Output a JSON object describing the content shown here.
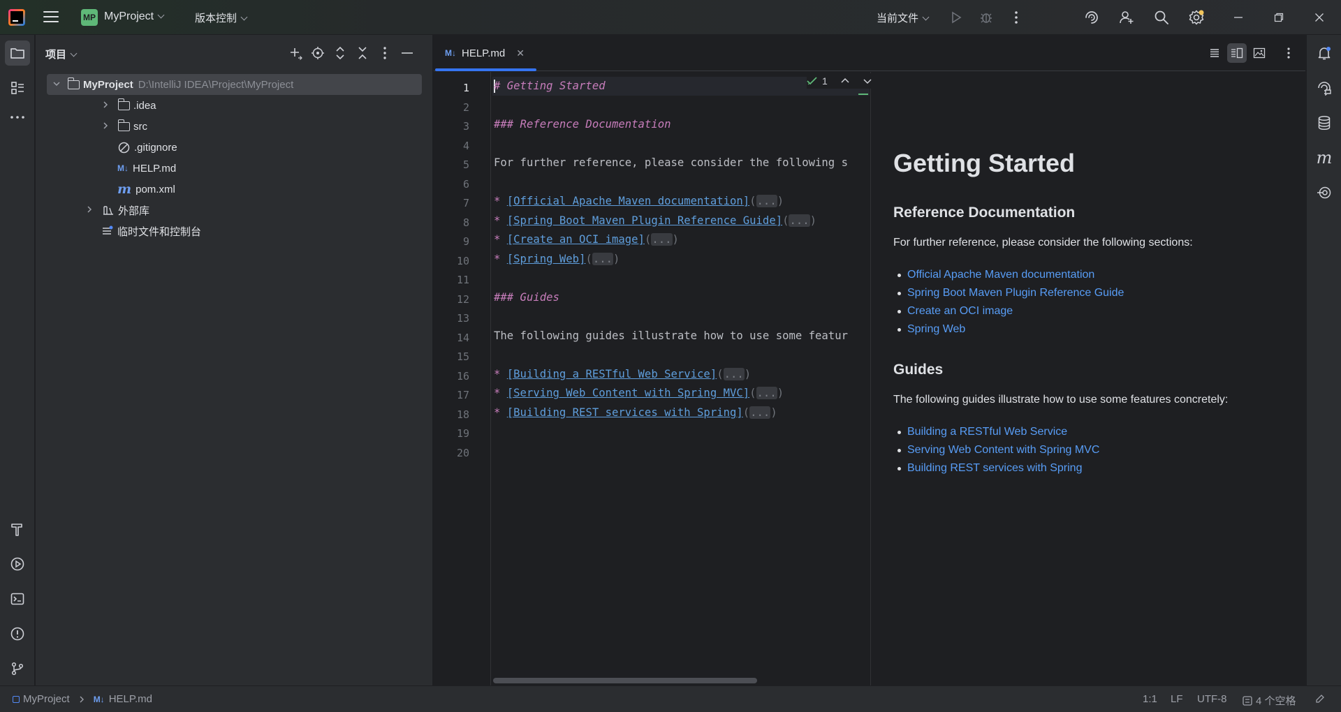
{
  "titlebar": {
    "project_badge": "MP",
    "project_name": "MyProject",
    "vcs_label": "版本控制",
    "run_config": "当前文件"
  },
  "project_panel": {
    "title": "项目",
    "tree": [
      {
        "name": "MyProject",
        "path": "D:\\IntelliJ IDEA\\Project\\MyProject"
      },
      {
        "name": ".idea"
      },
      {
        "name": "src"
      },
      {
        "name": ".gitignore"
      },
      {
        "name": "HELP.md"
      },
      {
        "name": "pom.xml"
      },
      {
        "name": "外部库"
      },
      {
        "name": "临时文件和控制台"
      }
    ]
  },
  "editor": {
    "tab_label": "HELP.md",
    "tab_badge": "M↓",
    "inspection_count": "1",
    "line_numbers": [
      "1",
      "2",
      "3",
      "4",
      "5",
      "6",
      "7",
      "8",
      "9",
      "10",
      "11",
      "12",
      "13",
      "14",
      "15",
      "16",
      "17",
      "18",
      "19",
      "20"
    ],
    "code": {
      "l1": "# Getting Started",
      "l3": "### Reference Documentation",
      "l5": "For further reference, please consider the following s",
      "l7": "Official Apache Maven documentation",
      "l8": "Spring Boot Maven Plugin Reference Guide",
      "l9": "Create an OCI image",
      "l10": "Spring Web",
      "l12": "### Guides",
      "l14": "The following guides illustrate how to use some featur",
      "l16": "Building a RESTful Web Service",
      "l17": "Serving Web Content with Spring MVC",
      "l18": "Building REST services with Spring",
      "fold": "..."
    },
    "preview": {
      "h1": "Getting Started",
      "h_ref": "Reference Documentation",
      "p_ref": "For further reference, please consider the following sections:",
      "ref_links": [
        "Official Apache Maven documentation",
        "Spring Boot Maven Plugin Reference Guide",
        "Create an OCI image",
        "Spring Web"
      ],
      "h_guides": "Guides",
      "p_guides": "The following guides illustrate how to use some features concretely:",
      "guide_links": [
        "Building a RESTful Web Service",
        "Serving Web Content with Spring MVC",
        "Building REST services with Spring"
      ]
    }
  },
  "statusbar": {
    "breadcrumb_project": "MyProject",
    "breadcrumb_file": "HELP.md",
    "breadcrumb_badge": "M↓",
    "position": "1:1",
    "line_sep": "LF",
    "encoding": "UTF-8",
    "indent": "4 个空格"
  },
  "colors": {
    "accent": "#3574f0",
    "link": "#589df6",
    "heading_md": "#c77dbb",
    "project_badge": "#5fb878"
  }
}
